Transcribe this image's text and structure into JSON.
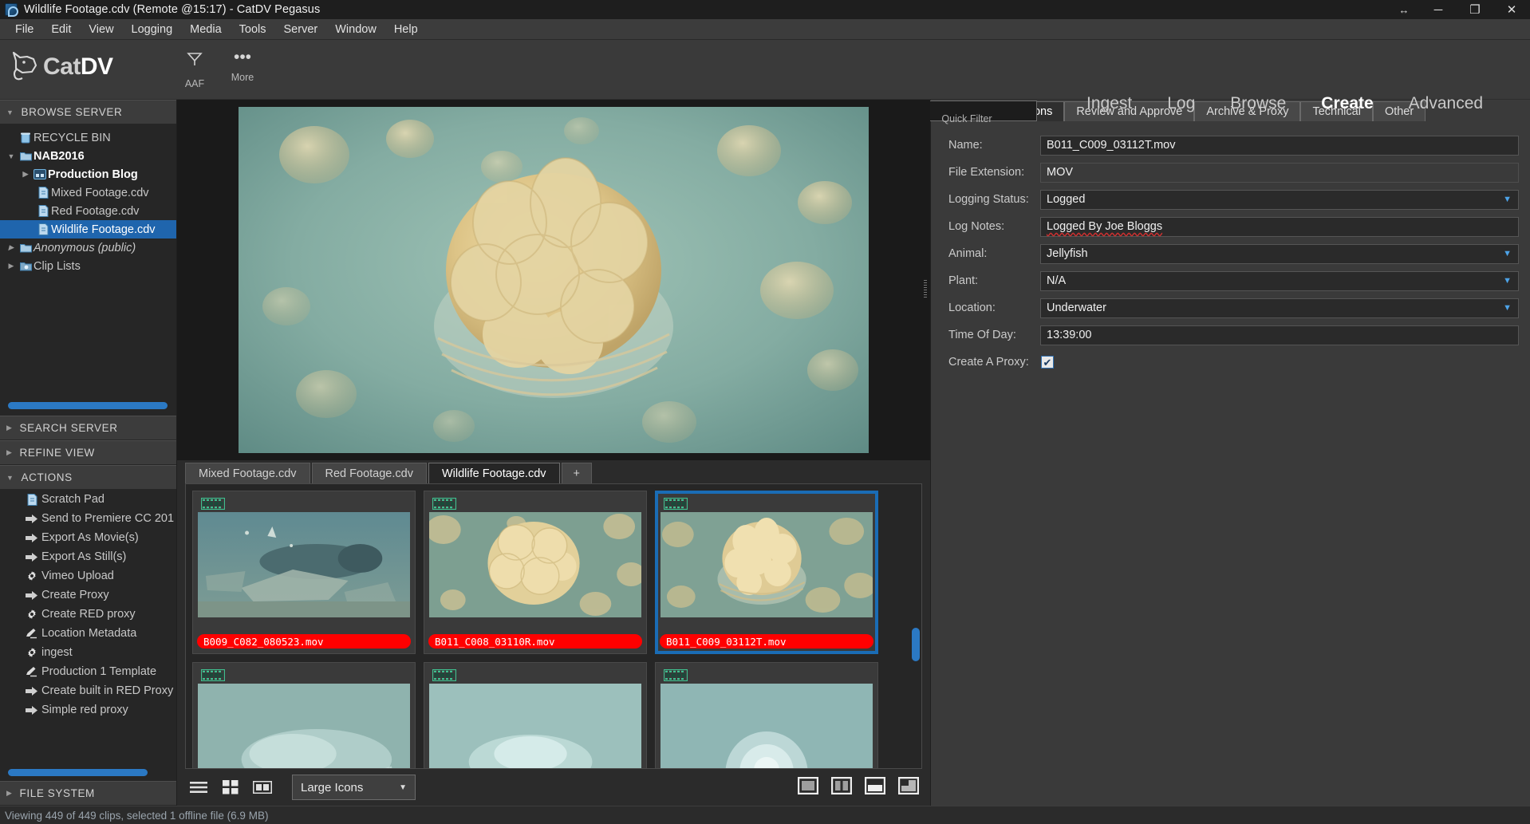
{
  "window": {
    "title": "Wildlife Footage.cdv (Remote @15:17) - CatDV Pegasus",
    "icon": "catdv-app-icon",
    "controls": {
      "resize": "↔",
      "minimize": "─",
      "maximize": "❐",
      "close": "✕"
    }
  },
  "menubar": [
    "File",
    "Edit",
    "View",
    "Logging",
    "Media",
    "Tools",
    "Server",
    "Window",
    "Help"
  ],
  "header": {
    "logo_text_light": "Cat",
    "logo_text_bold": "DV",
    "tools": [
      {
        "icon": "aaf-icon",
        "glyph": "⩒",
        "label": "AAF"
      },
      {
        "icon": "more-icon",
        "glyph": "•••",
        "label": "More"
      }
    ],
    "quick_filter_label": "Quick Filter",
    "search_placeholder": "",
    "search_value": "",
    "nav_tabs": [
      {
        "label": "Ingest",
        "active": false
      },
      {
        "label": "Log",
        "active": false
      },
      {
        "label": "Browse",
        "active": false
      },
      {
        "label": "Create",
        "active": true
      },
      {
        "label": "Advanced",
        "active": false
      }
    ]
  },
  "sidebar": {
    "browse_server": {
      "title": "BROWSE SERVER",
      "expanded": true,
      "tree": [
        {
          "label": "RECYCLE BIN",
          "icon": "trash-icon",
          "indent": 1,
          "arrow": "",
          "bold": false,
          "italic": false,
          "selected": false
        },
        {
          "label": "NAB2016",
          "icon": "folder-icon",
          "indent": 1,
          "arrow": "▼",
          "bold": true,
          "italic": false,
          "selected": false
        },
        {
          "label": "Production Blog",
          "icon": "smart-folder-icon",
          "indent": 2,
          "arrow": "▶",
          "bold": true,
          "italic": false,
          "selected": false
        },
        {
          "label": "Mixed Footage.cdv",
          "icon": "catalog-icon",
          "indent": 2,
          "arrow": "",
          "bold": false,
          "italic": false,
          "selected": false
        },
        {
          "label": "Red Footage.cdv",
          "icon": "catalog-icon",
          "indent": 2,
          "arrow": "",
          "bold": false,
          "italic": false,
          "selected": false
        },
        {
          "label": "Wildlife Footage.cdv",
          "icon": "catalog-icon",
          "indent": 2,
          "arrow": "",
          "bold": false,
          "italic": false,
          "selected": true
        },
        {
          "label": "Anonymous (public)",
          "icon": "folder-icon",
          "indent": 1,
          "arrow": "▶",
          "bold": false,
          "italic": true,
          "selected": false
        },
        {
          "label": "Clip Lists",
          "icon": "cliplist-folder-icon",
          "indent": 1,
          "arrow": "▶",
          "bold": false,
          "italic": false,
          "selected": false
        }
      ]
    },
    "search_server": {
      "title": "SEARCH SERVER",
      "expanded": false
    },
    "refine_view": {
      "title": "REFINE VIEW",
      "expanded": false
    },
    "actions": {
      "title": "ACTIONS",
      "expanded": true,
      "items": [
        {
          "label": "Scratch Pad",
          "icon": "document-icon"
        },
        {
          "label": "Send to Premiere CC 201",
          "icon": "arrow-right-icon"
        },
        {
          "label": "Export As Movie(s)",
          "icon": "arrow-right-icon"
        },
        {
          "label": "Export As Still(s)",
          "icon": "arrow-right-icon"
        },
        {
          "label": "Vimeo Upload",
          "icon": "gear-icon"
        },
        {
          "label": "Create Proxy",
          "icon": "arrow-right-icon"
        },
        {
          "label": "Create RED proxy",
          "icon": "gear-icon"
        },
        {
          "label": "Location Metadata",
          "icon": "pencil-icon"
        },
        {
          "label": "ingest",
          "icon": "gear-icon"
        },
        {
          "label": "Production 1 Template",
          "icon": "pencil-icon"
        },
        {
          "label": "Create built in RED Proxy",
          "icon": "arrow-right-icon"
        },
        {
          "label": "Simple red proxy",
          "icon": "arrow-right-icon"
        }
      ]
    },
    "file_system": {
      "title": "FILE SYSTEM",
      "expanded": false
    }
  },
  "preview": {
    "name": "preview-image",
    "caption": ""
  },
  "browser": {
    "tabs": [
      {
        "label": "Mixed Footage.cdv",
        "active": false
      },
      {
        "label": "Red Footage.cdv",
        "active": false
      },
      {
        "label": "Wildlife Footage.cdv",
        "active": true
      },
      {
        "label": "+",
        "active": false
      }
    ],
    "clips": [
      {
        "filename": "B009_C082_080523.mov",
        "selected": false,
        "thumb": "shark"
      },
      {
        "filename": "B011_C008_03110R.mov",
        "selected": false,
        "thumb": "jellyfish-cluster"
      },
      {
        "filename": "B011_C009_03112T.mov",
        "selected": true,
        "thumb": "jellyfish-gold"
      },
      {
        "filename": "",
        "selected": false,
        "thumb": "jelly-pale-1"
      },
      {
        "filename": "",
        "selected": false,
        "thumb": "jelly-pale-2"
      },
      {
        "filename": "",
        "selected": false,
        "thumb": "jelly-pale-3"
      }
    ],
    "view_buttons": [
      {
        "icon": "list-view-icon",
        "active": false
      },
      {
        "icon": "grid-view-icon",
        "active": false
      },
      {
        "icon": "filmstrip-view-icon",
        "active": false
      }
    ],
    "size_select": {
      "value": "Large Icons",
      "caret": "▼"
    },
    "layout_buttons": [
      {
        "icon": "layout-single-icon"
      },
      {
        "icon": "layout-split-vertical-icon"
      },
      {
        "icon": "layout-split-horizontal-icon"
      },
      {
        "icon": "layout-corner-icon"
      }
    ]
  },
  "metadata": {
    "tabs": [
      {
        "label": "Wildlife Productions",
        "active": true
      },
      {
        "label": "Review and Approve",
        "active": false
      },
      {
        "label": "Archive & Proxy",
        "active": false
      },
      {
        "label": "Technical",
        "active": false
      },
      {
        "label": "Other",
        "active": false
      }
    ],
    "fields": [
      {
        "label": "Name:",
        "value": "B011_C009_03112T.mov",
        "type": "text",
        "boxed": true
      },
      {
        "label": "File Extension:",
        "value": "MOV",
        "type": "text",
        "boxed": false
      },
      {
        "label": "Logging Status:",
        "value": "Logged",
        "type": "dropdown",
        "boxed": true
      },
      {
        "label": "Log Notes:",
        "value": "Logged By Joe Bloggs",
        "type": "text-spell",
        "boxed": true
      },
      {
        "label": "Animal:",
        "value": "Jellyfish",
        "type": "dropdown",
        "boxed": true
      },
      {
        "label": "Plant:",
        "value": "N/A",
        "type": "dropdown",
        "boxed": true
      },
      {
        "label": "Location:",
        "value": "Underwater",
        "type": "dropdown",
        "boxed": true
      },
      {
        "label": "Time Of Day:",
        "value": "13:39:00",
        "type": "text",
        "boxed": true
      },
      {
        "label": "Create A Proxy:",
        "value": "✔",
        "type": "checkbox",
        "boxed": false
      }
    ]
  },
  "statusbar": {
    "text": "Viewing 449 of 449 clips, selected 1 offline file (6.9 MB)"
  },
  "colors": {
    "accent_blue": "#1f65ad",
    "selection_blue": "#1a6cb5",
    "caption_red": "#ff0000",
    "scrollbar_blue": "#2b79c4",
    "panel_bg": "#3a3a3a",
    "dark_bg": "#262626"
  }
}
